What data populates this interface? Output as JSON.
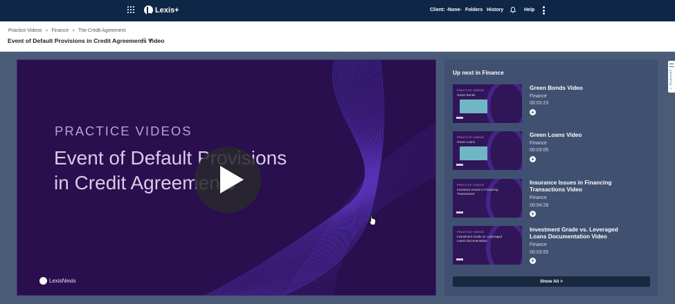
{
  "app": {
    "brand": "Lexis+",
    "nav": {
      "client": "Client: -None-",
      "folders": "Folders",
      "history": "History",
      "help": "Help"
    }
  },
  "breadcrumb": [
    "Practice Videos",
    "Finance",
    "The Credit Agreement"
  ],
  "breadcrumb_separator": "»",
  "page_title": "Event of Default Provisions in Credit Agreements Video",
  "title_plus": "+",
  "player": {
    "label": "PRACTICE VIDEOS",
    "title_line1": "Event of Default Provisions",
    "title_line2": "in Credit Agreements",
    "logo_text": "LexisNexis"
  },
  "upnext": {
    "heading": "Up next in Finance",
    "items": [
      {
        "title": "Green Bonds Video",
        "category": "Finance",
        "duration": "00:03:23",
        "thumb_label": "PRACTICE VIDEOS",
        "thumb_sub": "Green Bonds",
        "illustrated": true
      },
      {
        "title": "Green Loans Video",
        "category": "Finance",
        "duration": "00:03:05",
        "thumb_label": "PRACTICE VIDEOS",
        "thumb_sub": "Green Loans",
        "illustrated": true
      },
      {
        "title": "Insurance Issues in Financing Transactions Video",
        "category": "Finance",
        "duration": "00:04:28",
        "thumb_label": "PRACTICE VIDEOS",
        "thumb_sub": "Insurance Issues in Financing Transactions",
        "illustrated": false
      },
      {
        "title": "Investment Grade vs. Leveraged Loans Documentation Video",
        "category": "Finance",
        "duration": "00:03:55",
        "thumb_label": "PRACTICE VIDEOS",
        "thumb_sub": "Investment Grade vs. Leveraged Loans Documentation",
        "illustrated": false
      }
    ],
    "add_label": "+",
    "show_all": "Show All >"
  },
  "side_tab": {
    "label": "PLAYLIST"
  },
  "icons": {
    "apps": "apps-grid-icon",
    "bell": "bell-icon",
    "more": "kebab-menu-icon",
    "link": "link-icon",
    "play": "play-icon"
  },
  "colors": {
    "nav_bg": "#0f2747",
    "page_bg": "#4a5b78",
    "panel_bg": "#3f5070",
    "player_bg": "#2a0f4f"
  }
}
